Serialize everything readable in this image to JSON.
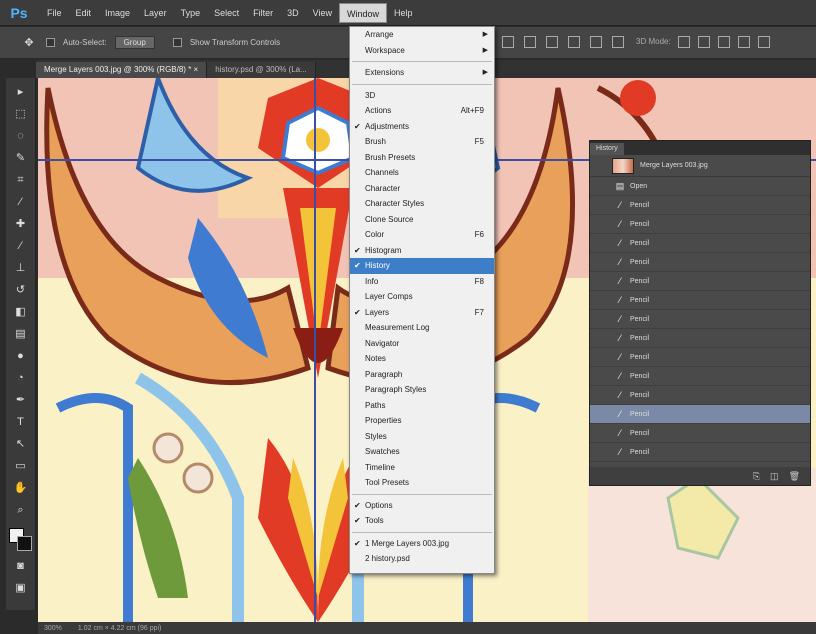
{
  "menubar": {
    "logo": "Ps",
    "items": [
      "File",
      "Edit",
      "Image",
      "Layer",
      "Type",
      "Select",
      "Filter",
      "3D",
      "View",
      "Window",
      "Help"
    ],
    "active_index": 9
  },
  "options": {
    "auto_select_label": "Auto-Select:",
    "group_value": "Group",
    "show_transform_label": "Show Transform Controls",
    "mode_label": "3D Mode:"
  },
  "tabs": [
    {
      "label": "Merge Layers 003.jpg @ 300% (RGB/8) * ×",
      "active": true
    },
    {
      "label": "history.psd @ 300% (La...",
      "active": false
    }
  ],
  "window_menu": {
    "groups": [
      [
        {
          "label": "Arrange",
          "submenu": true
        },
        {
          "label": "Workspace",
          "submenu": true
        }
      ],
      [
        {
          "label": "Extensions",
          "submenu": true
        }
      ],
      [
        {
          "label": "3D"
        },
        {
          "label": "Actions",
          "shortcut": "Alt+F9"
        },
        {
          "label": "Adjustments",
          "checked": true
        },
        {
          "label": "Brush",
          "shortcut": "F5"
        },
        {
          "label": "Brush Presets"
        },
        {
          "label": "Channels"
        },
        {
          "label": "Character"
        },
        {
          "label": "Character Styles"
        },
        {
          "label": "Clone Source"
        },
        {
          "label": "Color",
          "shortcut": "F6"
        },
        {
          "label": "Histogram",
          "checked": true
        },
        {
          "label": "History",
          "checked": true,
          "highlight": true
        },
        {
          "label": "Info",
          "shortcut": "F8"
        },
        {
          "label": "Layer Comps"
        },
        {
          "label": "Layers",
          "checked": true,
          "shortcut": "F7"
        },
        {
          "label": "Measurement Log"
        },
        {
          "label": "Navigator"
        },
        {
          "label": "Notes"
        },
        {
          "label": "Paragraph"
        },
        {
          "label": "Paragraph Styles"
        },
        {
          "label": "Paths"
        },
        {
          "label": "Properties"
        },
        {
          "label": "Styles"
        },
        {
          "label": "Swatches"
        },
        {
          "label": "Timeline"
        },
        {
          "label": "Tool Presets"
        }
      ],
      [
        {
          "label": "Options",
          "checked": true
        },
        {
          "label": "Tools",
          "checked": true
        }
      ],
      [
        {
          "label": "1 Merge Layers 003.jpg",
          "checked": true
        },
        {
          "label": "2 history.psd"
        }
      ]
    ]
  },
  "history": {
    "tab_label": "History",
    "snapshot_label": "Merge Layers 003.jpg",
    "states": [
      {
        "label": "Open",
        "icon": "document-icon"
      },
      {
        "label": "Pencil",
        "icon": "pencil-icon"
      },
      {
        "label": "Pencil",
        "icon": "pencil-icon"
      },
      {
        "label": "Pencil",
        "icon": "pencil-icon"
      },
      {
        "label": "Pencil",
        "icon": "pencil-icon"
      },
      {
        "label": "Pencil",
        "icon": "pencil-icon"
      },
      {
        "label": "Pencil",
        "icon": "pencil-icon"
      },
      {
        "label": "Pencil",
        "icon": "pencil-icon"
      },
      {
        "label": "Pencil",
        "icon": "pencil-icon"
      },
      {
        "label": "Pencil",
        "icon": "pencil-icon"
      },
      {
        "label": "Pencil",
        "icon": "pencil-icon"
      },
      {
        "label": "Pencil",
        "icon": "pencil-icon"
      },
      {
        "label": "Pencil",
        "icon": "pencil-icon",
        "selected": true
      },
      {
        "label": "Pencil",
        "icon": "pencil-icon"
      },
      {
        "label": "Pencil",
        "icon": "pencil-icon"
      }
    ]
  },
  "status": {
    "zoom": "300%",
    "doc_info": "1.02 cm × 4.22 cm (96 ppi)"
  },
  "colors": {
    "accent": "#3d7ec8",
    "foreground_swatch": "#f1f1f1",
    "background_swatch": "#111111"
  }
}
